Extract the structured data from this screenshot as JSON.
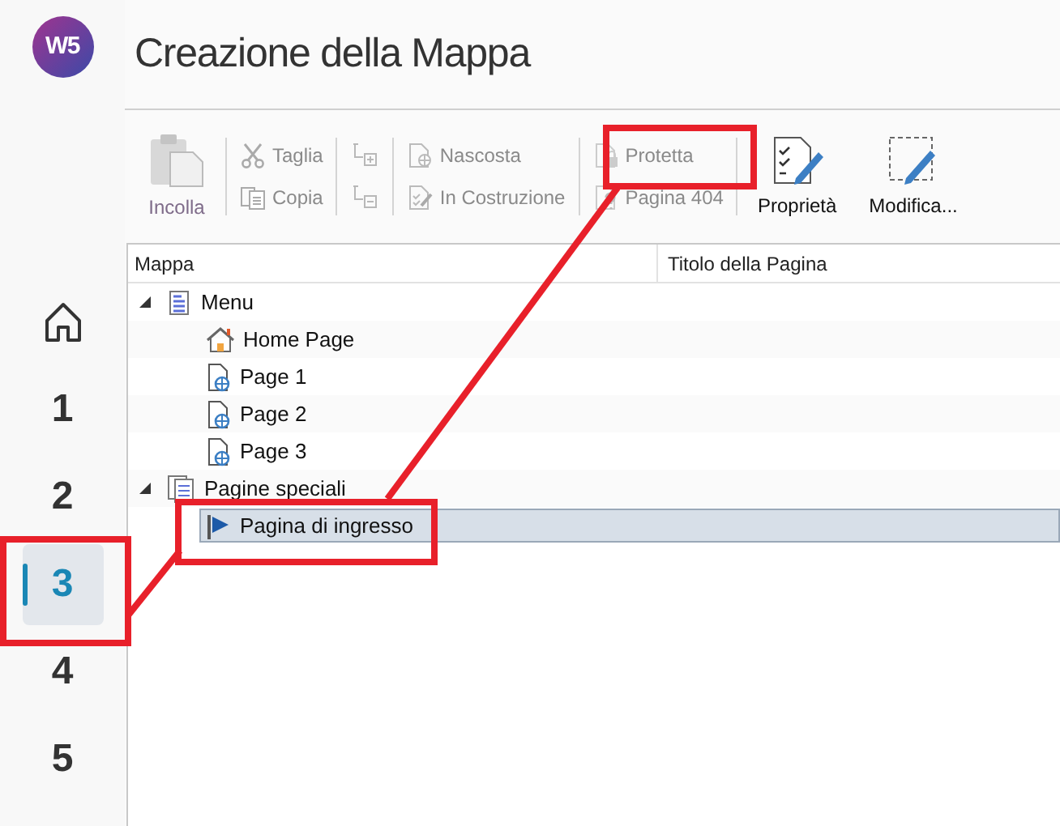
{
  "logo": {
    "text": "W5"
  },
  "title": "Creazione della Mappa",
  "rail": [
    {
      "kind": "home",
      "selected": false
    },
    {
      "kind": "step",
      "label": "1",
      "selected": false
    },
    {
      "kind": "step",
      "label": "2",
      "selected": false
    },
    {
      "kind": "step",
      "label": "3",
      "selected": true
    },
    {
      "kind": "step",
      "label": "4",
      "selected": false
    },
    {
      "kind": "step",
      "label": "5",
      "selected": false
    }
  ],
  "toolbar": [
    [
      {
        "kind": "paste",
        "label": "Incolla",
        "disabled": true
      }
    ],
    [
      {
        "kind": "cut",
        "label": "Taglia",
        "disabled": true
      },
      {
        "kind": "copy",
        "label": "Copia",
        "disabled": true
      }
    ],
    [
      {
        "kind": "indent",
        "disabled": true
      },
      {
        "kind": "outdent",
        "disabled": true
      }
    ],
    [
      {
        "kind": "hidden",
        "label": "Nascosta",
        "disabled": true
      },
      {
        "kind": "construction",
        "label": "In Costruzione",
        "disabled": true
      }
    ],
    [
      {
        "kind": "protected",
        "label": "Protetta",
        "disabled": true
      },
      {
        "kind": "notfound",
        "label": "Pagina 404",
        "disabled": true
      }
    ],
    [
      {
        "kind": "properties",
        "label": "Proprietà",
        "disabled": false
      },
      {
        "kind": "edit",
        "label": "Modifica...",
        "disabled": false
      }
    ]
  ],
  "table": {
    "columns": [
      "Mappa",
      "Titolo della Pagina"
    ],
    "tree": [
      {
        "kind": "menu",
        "label": "Menu",
        "expanded": true,
        "selected": false,
        "children": [
          {
            "kind": "home",
            "label": "Home Page",
            "selected": false
          },
          {
            "kind": "page",
            "label": "Page 1",
            "selected": false
          },
          {
            "kind": "page",
            "label": "Page 2",
            "selected": false
          },
          {
            "kind": "page",
            "label": "Page 3",
            "selected": false
          }
        ]
      },
      {
        "kind": "special",
        "label": "Pagine speciali",
        "expanded": true,
        "selected": false,
        "children": [
          {
            "kind": "entry",
            "label": "Pagina di ingresso",
            "selected": true
          }
        ]
      }
    ]
  }
}
